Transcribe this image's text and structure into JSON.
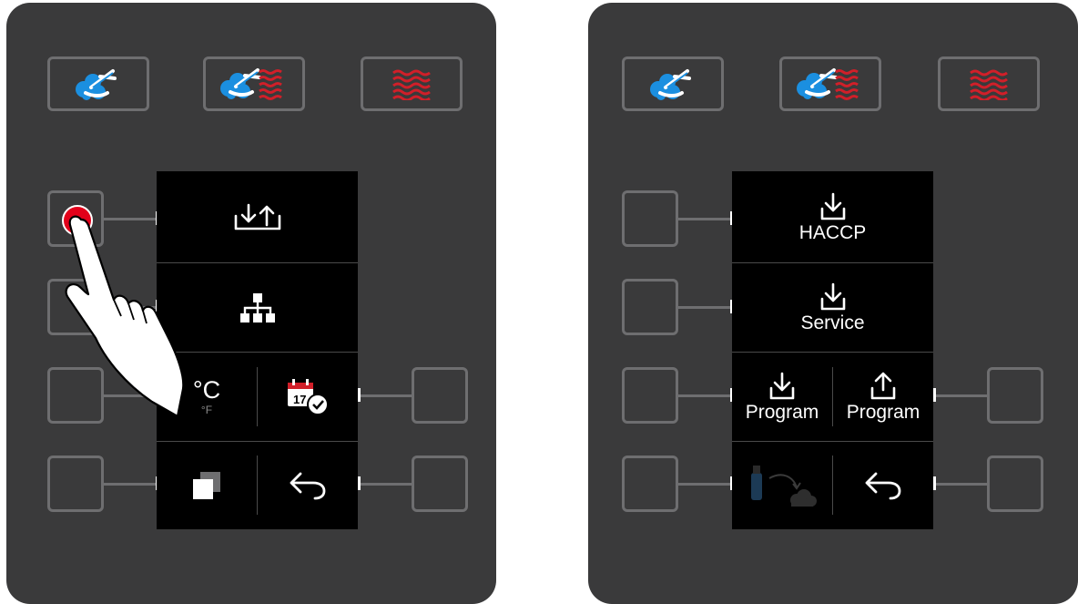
{
  "colors": {
    "panel": "#3a3a3b",
    "button_border": "#6e6e70",
    "display": "#000000",
    "steam_blue": "#1b8fe0",
    "heat_red": "#d11f29",
    "pressed_red": "#e2001a"
  },
  "left_panel": {
    "mode_buttons": [
      {
        "icon": "steam-icon"
      },
      {
        "icon": "combi-steam-heat-icon"
      },
      {
        "icon": "hot-air-icon"
      }
    ],
    "display": {
      "cells": [
        {
          "icon": "import-export-icon"
        },
        {
          "icon": "network-icon"
        },
        {
          "main": "°C",
          "sub": "°F",
          "icon": "temperature-unit-icon"
        },
        {
          "icon": "calendar-clock-icon",
          "day": "17"
        },
        {
          "icon": "copy-icon"
        },
        {
          "icon": "back-icon"
        }
      ]
    },
    "pressed_button": "top-left",
    "hand_icon": "pointing-hand-icon"
  },
  "right_panel": {
    "mode_buttons": [
      {
        "icon": "steam-icon"
      },
      {
        "icon": "combi-steam-heat-icon"
      },
      {
        "icon": "hot-air-icon"
      }
    ],
    "display": {
      "cells": [
        {
          "icon": "download-icon",
          "label": "HACCP"
        },
        {
          "icon": "download-icon",
          "label": "Service"
        },
        {
          "icon": "download-icon",
          "label": "Program"
        },
        {
          "icon": "upload-icon",
          "label": "Program"
        },
        {
          "icon": "usb-cloud-icon",
          "disabled": true
        },
        {
          "icon": "back-icon"
        }
      ]
    }
  }
}
